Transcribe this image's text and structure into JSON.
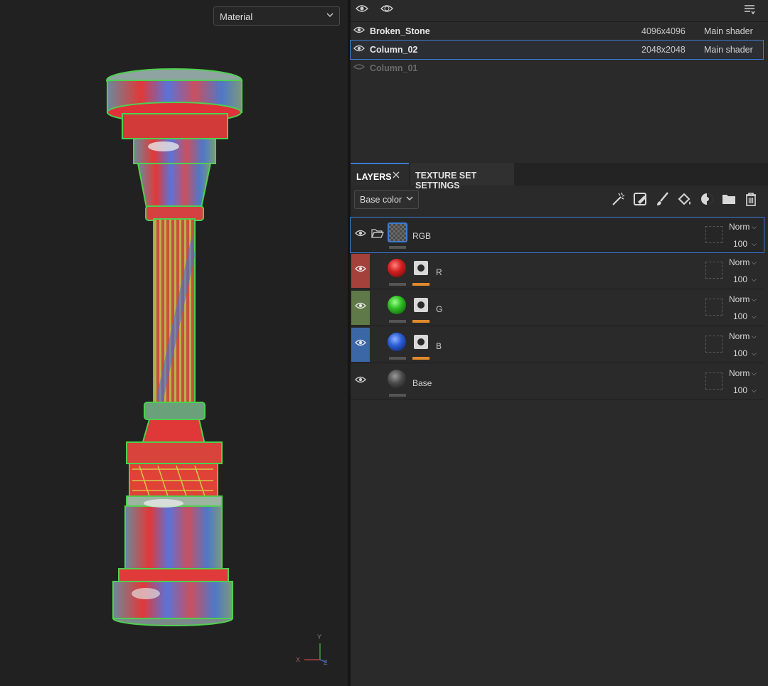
{
  "viewport": {
    "mode_select": "Material",
    "axis_labels": {
      "y": "Y",
      "x": "X",
      "z": "Z"
    }
  },
  "texture_sets": {
    "rows": [
      {
        "name": "Broken_Stone",
        "resolution": "4096x4096",
        "shader": "Main shader",
        "visible": true,
        "selected": false
      },
      {
        "name": "Column_02",
        "resolution": "2048x2048",
        "shader": "Main shader",
        "visible": true,
        "selected": true
      },
      {
        "name": "Column_01",
        "resolution": "",
        "shader": "",
        "visible": false,
        "selected": false
      }
    ]
  },
  "tabs": {
    "layers": "LAYERS",
    "texture_set_settings": "TEXTURE SET SETTINGS"
  },
  "layers_panel": {
    "channel": "Base color",
    "toolbar_icons": [
      "magic-wand-icon",
      "fill-layer-icon",
      "paint-brush-icon",
      "paint-bucket-icon",
      "mask-icon",
      "folder-icon",
      "trash-icon"
    ],
    "layers": [
      {
        "name": "RGB",
        "type": "folder",
        "blend": "Norm",
        "opacity": "100",
        "color": "#262626"
      },
      {
        "name": "R",
        "type": "fill",
        "blend": "Norm",
        "opacity": "100",
        "color": "#a3413a",
        "sphere": "#d42020"
      },
      {
        "name": "G",
        "type": "fill",
        "blend": "Norm",
        "opacity": "100",
        "color": "#5f7a48",
        "sphere": "#2fbf24"
      },
      {
        "name": "B",
        "type": "fill",
        "blend": "Norm",
        "opacity": "100",
        "color": "#3b67a6",
        "sphere": "#2b5fd8"
      },
      {
        "name": "Base",
        "type": "paint",
        "blend": "Norm",
        "opacity": "100",
        "color": "#2a2a2a",
        "sphere": "#4a4a4a"
      }
    ]
  }
}
